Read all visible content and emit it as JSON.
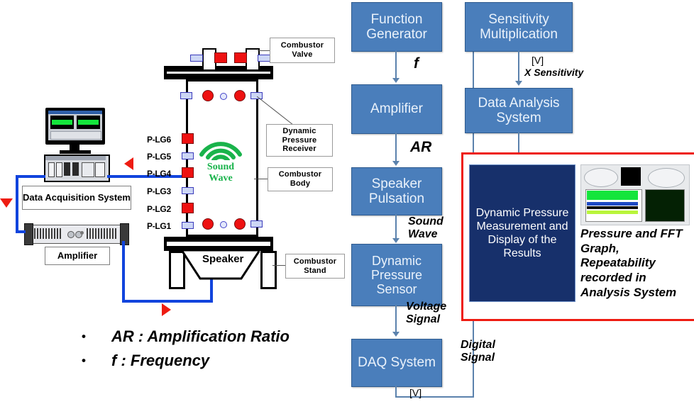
{
  "flow": {
    "boxes": [
      {
        "id": "function-generator",
        "label": "Function Generator"
      },
      {
        "id": "amplifier",
        "label": "Amplifier"
      },
      {
        "id": "speaker-pulsation",
        "label": "Speaker Pulsation"
      },
      {
        "id": "dynamic-pressure-sensor",
        "label": "Dynamic Pressure Sensor"
      },
      {
        "id": "daq-system",
        "label": "DAQ System"
      },
      {
        "id": "sensitivity-multiplication",
        "label": "Sensitivity Multiplication"
      },
      {
        "id": "data-analysis-system",
        "label": "Data Analysis System"
      }
    ],
    "edge_labels": {
      "f": "f",
      "ar": "AR",
      "sound_wave": "Sound\nWave",
      "voltage_signal": "Voltage\nSignal",
      "volts_daq": "[V]",
      "digital_signal": "Digital\nSignal",
      "volts_sensitivity": "[V]",
      "x_sensitivity": "X Sensitivity"
    }
  },
  "result_panel": {
    "navy_box_label": "Dynamic Pressure Measurement and Display of the Results",
    "caption": "Pressure and FFT Graph, Repeatability recorded in Analysis System",
    "border_color": "#ee1c12"
  },
  "apparatus": {
    "callouts": [
      {
        "id": "combustor-valve",
        "label": "Combustor Valve"
      },
      {
        "id": "dynamic-pressure-receiver",
        "label": "Dynamic Pressure Receiver"
      },
      {
        "id": "combustor-body",
        "label": "Combustor Body"
      },
      {
        "id": "combustor-stand",
        "label": "Combustor Stand"
      }
    ],
    "port_labels": [
      "P-LG6",
      "P-LG5",
      "P-LG4",
      "P-LG3",
      "P-LG2",
      "P-LG1"
    ],
    "sound_wave_label": "Sound\nWave",
    "speaker_label": "Speaker",
    "equipment": [
      {
        "id": "data-acquisition-system",
        "label": "Data Acquisition System"
      },
      {
        "id": "amplifier-rack",
        "label": "Amplifier"
      }
    ]
  },
  "legend": {
    "items": [
      {
        "bullet": "•",
        "text": "AR : Amplification Ratio"
      },
      {
        "bullet": "•",
        "text": "f : Frequency"
      }
    ]
  },
  "colors": {
    "flow_box": "#4a7ebb",
    "navy": "#17306b",
    "red": "#ee1c12",
    "wire_blue": "#1144dd",
    "sound_green": "#19b34b"
  }
}
